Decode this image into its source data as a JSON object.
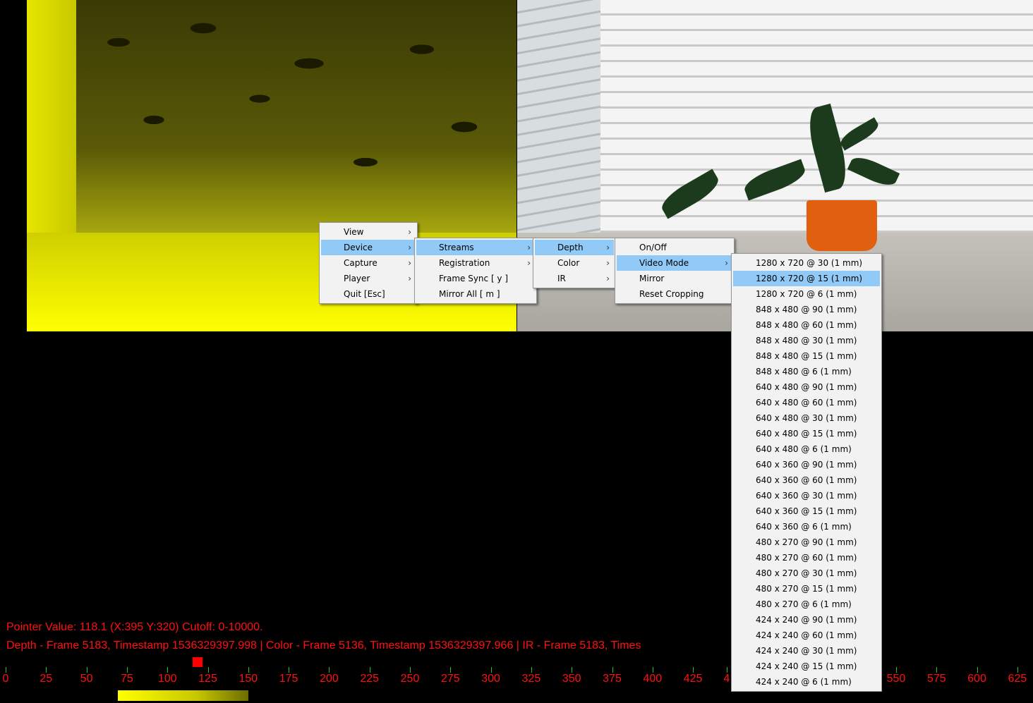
{
  "status": {
    "pointer_line": "Pointer Value: 118.1 (X:395 Y:320) Cutoff: 0-10000.",
    "frames_line": "Depth - Frame 5183, Timestamp 1536329397.998 | Color - Frame 5136, Timestamp 1536329397.966 | IR - Frame 5183, Times"
  },
  "ruler": {
    "labels": [
      "0",
      "25",
      "50",
      "75",
      "100",
      "125",
      "150",
      "175",
      "200",
      "225",
      "250",
      "275",
      "300",
      "325",
      "350",
      "375",
      "400",
      "425",
      "4",
      "550",
      "575",
      "600",
      "625"
    ]
  },
  "menus": {
    "main": {
      "items": [
        {
          "label": "View",
          "submenu": true
        },
        {
          "label": "Device",
          "submenu": true
        },
        {
          "label": "Capture",
          "submenu": true
        },
        {
          "label": "Player",
          "submenu": true
        },
        {
          "label": "Quit [Esc]",
          "submenu": false
        }
      ]
    },
    "device": {
      "items": [
        {
          "label": "Streams",
          "submenu": true
        },
        {
          "label": "Registration",
          "submenu": true
        },
        {
          "label": "Frame Sync [ y ]",
          "submenu": false
        },
        {
          "label": "Mirror All [ m ]",
          "submenu": false
        }
      ]
    },
    "streams": {
      "items": [
        {
          "label": "Depth",
          "submenu": true
        },
        {
          "label": "Color",
          "submenu": true
        },
        {
          "label": "IR",
          "submenu": true
        }
      ]
    },
    "depth": {
      "items": [
        {
          "label": "On/Off",
          "submenu": false
        },
        {
          "label": "Video Mode",
          "submenu": true
        },
        {
          "label": "Mirror",
          "submenu": false
        },
        {
          "label": "Reset Cropping",
          "submenu": false
        }
      ]
    },
    "video_mode": {
      "items": [
        "1280 x 720 @ 30 (1 mm)",
        "1280 x 720 @ 15 (1 mm)",
        "1280 x 720 @ 6 (1 mm)",
        "848 x 480 @ 90 (1 mm)",
        "848 x 480 @ 60 (1 mm)",
        "848 x 480 @ 30 (1 mm)",
        "848 x 480 @ 15 (1 mm)",
        "848 x 480 @ 6 (1 mm)",
        "640 x 480 @ 90 (1 mm)",
        "640 x 480 @ 60 (1 mm)",
        "640 x 480 @ 30 (1 mm)",
        "640 x 480 @ 15 (1 mm)",
        "640 x 480 @ 6 (1 mm)",
        "640 x 360 @ 90 (1 mm)",
        "640 x 360 @ 60 (1 mm)",
        "640 x 360 @ 30 (1 mm)",
        "640 x 360 @ 15 (1 mm)",
        "640 x 360 @ 6 (1 mm)",
        "480 x 270 @ 90 (1 mm)",
        "480 x 270 @ 60 (1 mm)",
        "480 x 270 @ 30 (1 mm)",
        "480 x 270 @ 15 (1 mm)",
        "480 x 270 @ 6 (1 mm)",
        "424 x 240 @ 90 (1 mm)",
        "424 x 240 @ 60 (1 mm)",
        "424 x 240 @ 30 (1 mm)",
        "424 x 240 @ 15 (1 mm)",
        "424 x 240 @ 6 (1 mm)"
      ],
      "highlighted": "1280 x 720 @ 15 (1 mm)"
    }
  },
  "colors": {
    "status_text": "#ff1010",
    "menu_highlight": "#91c9f7",
    "tick": "#20c020"
  }
}
